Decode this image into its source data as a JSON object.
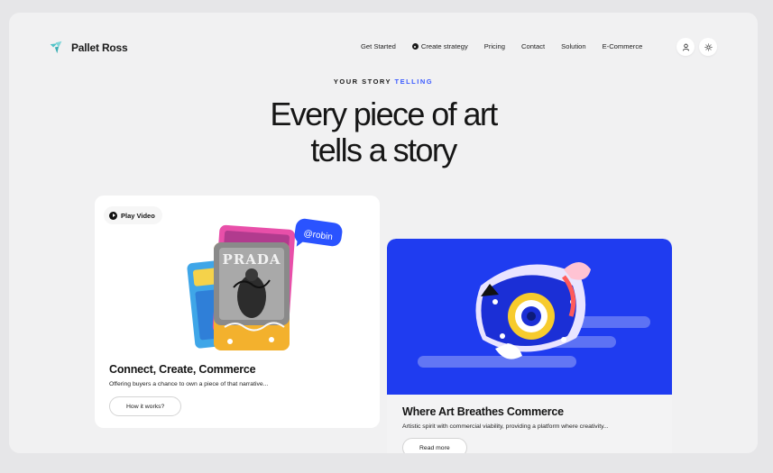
{
  "brand": {
    "name": "Pallet Ross",
    "accent_color": "#4fc3c8"
  },
  "nav": {
    "items": [
      {
        "label": "Get Started",
        "icon": ""
      },
      {
        "label": "Create strategy",
        "icon": "sparkle-icon"
      },
      {
        "label": "Pricing",
        "icon": ""
      },
      {
        "label": "Contact",
        "icon": ""
      },
      {
        "label": "Solution",
        "icon": ""
      },
      {
        "label": "E-Commerce",
        "icon": ""
      }
    ],
    "icons": [
      "user-icon",
      "sun-icon"
    ]
  },
  "hero": {
    "eyebrow_prefix": "YOUR STORY",
    "eyebrow_accent": "TELLING",
    "headline_line1": "Every piece of art",
    "headline_line2": "tells a story",
    "accent_color": "#3b5bff"
  },
  "card_left": {
    "play_label": "Play Video",
    "tag": "@robin",
    "poster_text": "PRADA",
    "title": "Connect, Create, Commerce",
    "description": "Offering buyers a chance to own a piece of that narrative...",
    "button_label": "How it works?"
  },
  "card_right": {
    "title": "Where Art Breathes Commerce",
    "description": "Artistic spirit with commercial viability, providing a platform where creativity...",
    "button_label": "Read more",
    "bg_color": "#1f3cf0"
  }
}
